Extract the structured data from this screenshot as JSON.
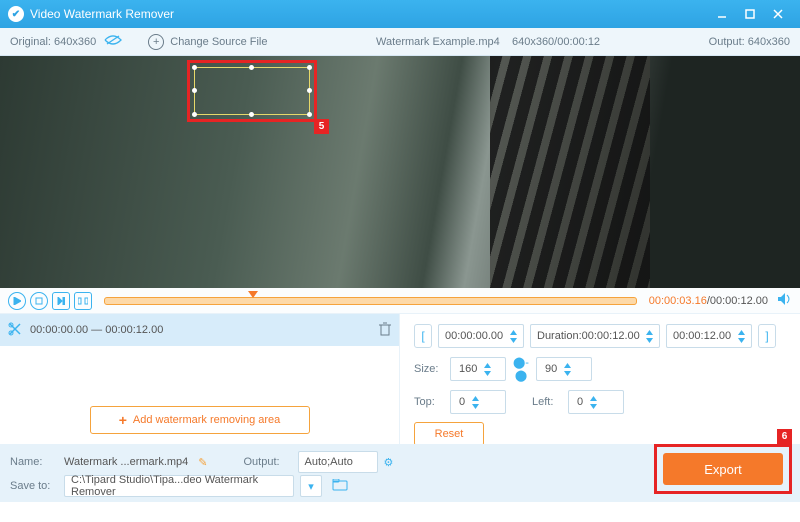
{
  "titlebar": {
    "title": "Video Watermark Remover"
  },
  "toolbar": {
    "original_label": "Original:",
    "original_dim": "640x360",
    "change_label": "Change Source File",
    "filename": "Watermark Example.mp4",
    "dim_time": "640x360/00:00:12",
    "output_label": "Output:",
    "output_dim": "640x360"
  },
  "callouts": {
    "five": "5",
    "six": "6"
  },
  "playbar": {
    "current": "00:00:03.16",
    "total": "/00:00:12.00"
  },
  "segment": {
    "range": "00:00:00.00 — 00:00:12.00"
  },
  "addwm": {
    "label": "Add watermark removing area"
  },
  "controls": {
    "start": "00:00:00.00",
    "duration_label": "Duration:",
    "duration": "00:00:12.00",
    "end": "00:00:12.00",
    "size_label": "Size:",
    "w": "160",
    "h": "90",
    "top_label": "Top:",
    "top": "0",
    "left_label": "Left:",
    "left": "0",
    "reset": "Reset"
  },
  "bottom": {
    "name_label": "Name:",
    "name_value": "Watermark ...ermark.mp4",
    "output_label": "Output:",
    "output_value": "Auto;Auto",
    "save_label": "Save to:",
    "save_path": "C:\\Tipard Studio\\Tipa...deo Watermark Remover",
    "export": "Export"
  }
}
